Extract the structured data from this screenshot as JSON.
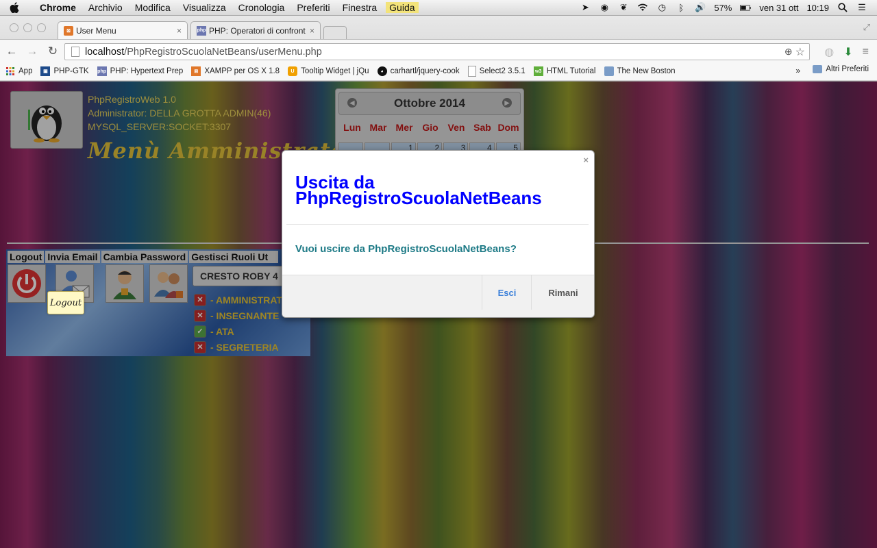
{
  "menubar": {
    "apple_icon": "apple-icon",
    "items": [
      "Chrome",
      "Archivio",
      "Modifica",
      "Visualizza",
      "Cronologia",
      "Preferiti",
      "Finestra",
      "Guida"
    ],
    "battery": "57%",
    "date": "ven 31 ott",
    "time": "10:19"
  },
  "browser": {
    "tabs": [
      {
        "title": "User Menu",
        "active": true
      },
      {
        "title": "PHP: Operatori di confronto",
        "active": false
      }
    ],
    "url_host": "localhost",
    "url_path": "/PhpRegistroScuolaNetBeans/userMenu.php",
    "bookmarks": [
      {
        "label": "App"
      },
      {
        "label": "PHP-GTK"
      },
      {
        "label": "PHP: Hypertext Prep"
      },
      {
        "label": "XAMPP per OS X 1.8"
      },
      {
        "label": "Tooltip Widget | jQu"
      },
      {
        "label": "carhartl/jquery-cook"
      },
      {
        "label": "Select2 3.5.1"
      },
      {
        "label": "HTML Tutorial"
      },
      {
        "label": "The New Boston"
      }
    ],
    "bookmarks_more": "»",
    "other_bookmarks": "Altri Preferiti"
  },
  "page": {
    "app_name": "PhpRegistroWeb 1.0",
    "admin_line": "Administrator: DELLA GROTTA ADMIN(46)",
    "server_line": "MYSQL_SERVER:SOCKET:3307",
    "menu_title": "Menù Amministratore",
    "calendar": {
      "month": "Ottobre 2014",
      "days": [
        "Lun",
        "Mar",
        "Mer",
        "Gio",
        "Ven",
        "Sab",
        "Dom"
      ],
      "first_row": [
        "",
        "",
        "1",
        "2",
        "3",
        "4",
        "5"
      ]
    },
    "panel": {
      "headers": [
        "Logout",
        "Invia Email",
        "Cambia Password",
        "Gestisci Ruoli Ut"
      ],
      "selected_user": "CRESTO ROBY 4",
      "roles": [
        {
          "label": "- AMMINISTRAT",
          "checked": false
        },
        {
          "label": "- INSEGNANTE",
          "checked": false
        },
        {
          "label": "- ATA",
          "checked": true
        },
        {
          "label": "- SEGRETERIA",
          "checked": false
        }
      ],
      "tooltip": "Logout"
    }
  },
  "modal": {
    "title": "Uscita da PhpRegistroScuolaNetBeans",
    "close": "×",
    "message": "Vuoi uscire da PhpRegistroScuolaNetBeans?",
    "confirm": "Esci",
    "cancel": "Rimani"
  },
  "colors": {
    "modal_title": "#0000ff",
    "modal_message": "#1d7a86",
    "confirm_button": "#3a7fd9",
    "app_info": "#e8d25a"
  }
}
